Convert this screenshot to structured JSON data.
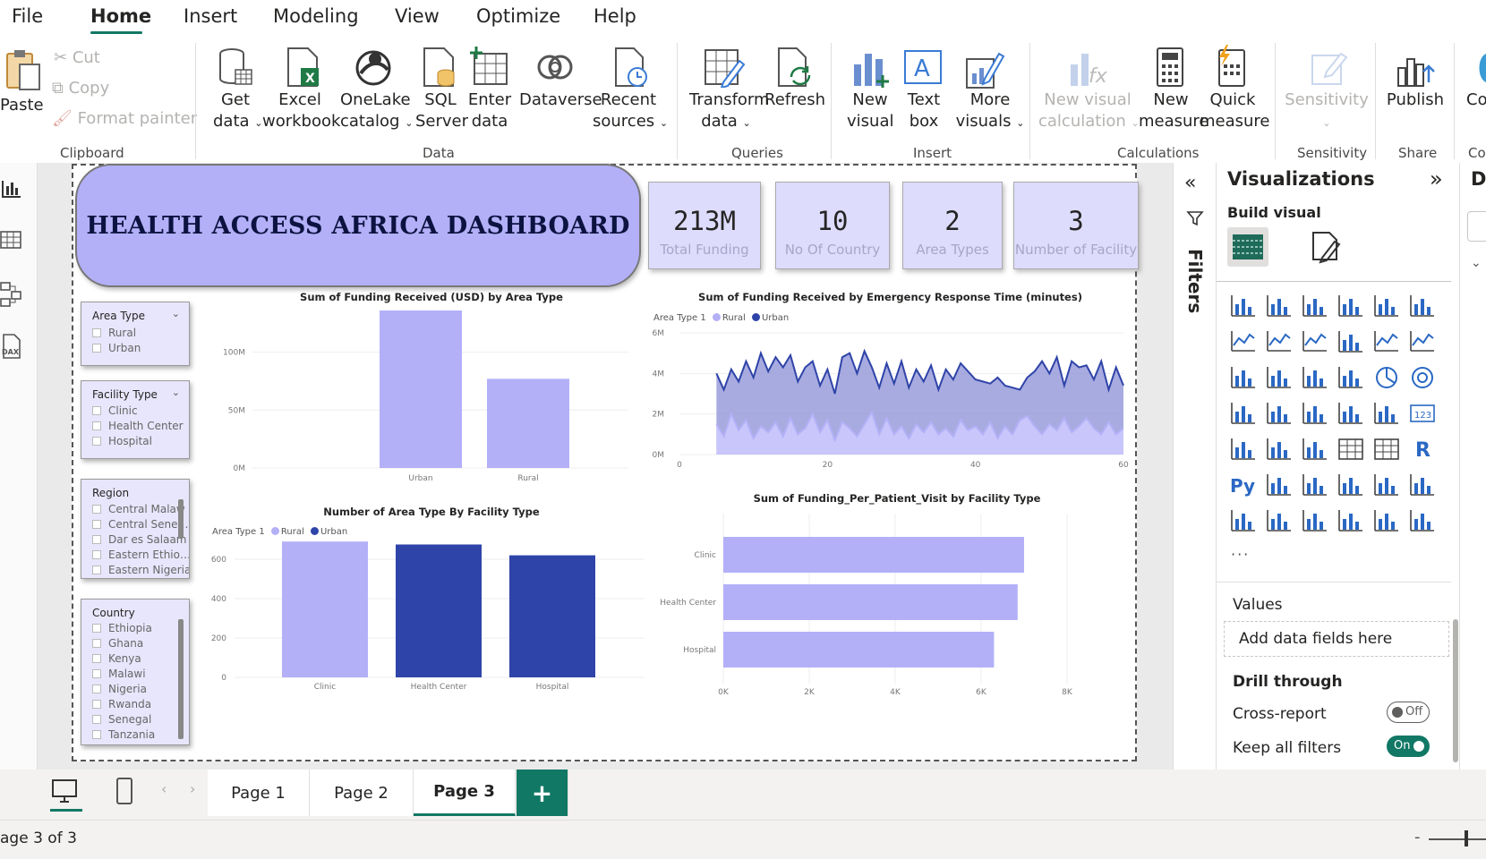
{
  "menu": {
    "items": [
      "File",
      "Home",
      "Insert",
      "Modeling",
      "View",
      "Optimize",
      "Help"
    ],
    "active": "Home"
  },
  "ribbon": {
    "clipboard": {
      "paste": "Paste",
      "cut": "Cut",
      "copy": "Copy",
      "format_painter": "Format painter",
      "group": "Clipboard"
    },
    "data": {
      "get_data": [
        "Get",
        "data"
      ],
      "excel": [
        "Excel",
        "workbook"
      ],
      "onelake": [
        "OneLake",
        "catalog"
      ],
      "sql": [
        "SQL",
        "Server"
      ],
      "enter": [
        "Enter",
        "data"
      ],
      "dataverse": "Dataverse",
      "recent": [
        "Recent",
        "sources"
      ],
      "group": "Data"
    },
    "queries": {
      "transform": [
        "Transform",
        "data"
      ],
      "refresh": "Refresh",
      "group": "Queries"
    },
    "insert": {
      "new_visual": [
        "New",
        "visual"
      ],
      "text_box": [
        "Text",
        "box"
      ],
      "more_visuals": [
        "More",
        "visuals"
      ],
      "group": "Insert"
    },
    "calculations": {
      "new_visual_calc": [
        "New visual",
        "calculation"
      ],
      "new_measure": [
        "New",
        "measure"
      ],
      "quick_measure": [
        "Quick",
        "measure"
      ],
      "group": "Calculations"
    },
    "sensitivity": {
      "label": "Sensitivity",
      "group": "Sensitivity"
    },
    "share": {
      "publish": "Publish",
      "group": "Share",
      "cut_label": "Co"
    }
  },
  "report": {
    "title": "HEALTH ACCESS AFRICA DASHBOARD",
    "kpis": [
      {
        "value": "213M",
        "label": "Total Funding"
      },
      {
        "value": "10",
        "label": "No Of Country"
      },
      {
        "value": "2",
        "label": "Area Types"
      },
      {
        "value": "3",
        "label": "Number of Facility"
      }
    ],
    "slicers": {
      "area_type": {
        "title": "Area Type",
        "items": [
          "Rural",
          "Urban"
        ]
      },
      "facility_type": {
        "title": "Facility Type",
        "items": [
          "Clinic",
          "Health Center",
          "Hospital"
        ]
      },
      "region": {
        "title": "Region",
        "items": [
          "Central Malaw",
          "Central Sene…",
          "Dar es Salaam",
          "Eastern Ethio…",
          "Eastern Nigeria"
        ]
      },
      "country": {
        "title": "Country",
        "items": [
          "Ethiopia",
          "Ghana",
          "Kenya",
          "Malawi",
          "Nigeria",
          "Rwanda",
          "Senegal",
          "Tanzania"
        ]
      }
    }
  },
  "colors": {
    "light_purple": "#b3b0f8",
    "navy": "#2f44a8",
    "teal": "#117865"
  },
  "chart_data": [
    {
      "type": "bar",
      "title": "Sum of Funding Received (USD) by Area Type",
      "categories": [
        "Urban",
        "Rural"
      ],
      "values": [
        136000000,
        77000000
      ],
      "ylim": [
        0,
        136000000
      ],
      "yticks": [
        "0M",
        "50M",
        "100M"
      ],
      "ytick_values": [
        0,
        50000000,
        100000000
      ]
    },
    {
      "type": "area",
      "title": "Sum of Funding Received by Emergency Response Time (minutes)",
      "legend_title": "Area Type 1",
      "legend": [
        "Rural",
        "Urban"
      ],
      "x": [
        5,
        6,
        7,
        8,
        9,
        10,
        11,
        12,
        13,
        14,
        15,
        16,
        17,
        18,
        19,
        20,
        21,
        22,
        23,
        24,
        25,
        26,
        27,
        28,
        29,
        30,
        31,
        32,
        33,
        34,
        35,
        36,
        37,
        38,
        39,
        40,
        41,
        42,
        43,
        44,
        45,
        46,
        47,
        48,
        49,
        50,
        51,
        52,
        53,
        54,
        55,
        56,
        57,
        58,
        59,
        60
      ],
      "series": [
        {
          "name": "Urban",
          "values": [
            4.0,
            3.2,
            4.2,
            3.6,
            4.6,
            3.8,
            5.0,
            4.1,
            4.8,
            4.3,
            4.9,
            3.6,
            4.3,
            4.6,
            3.4,
            4.2,
            3.0,
            4.8,
            5.0,
            4.0,
            5.1,
            4.3,
            3.3,
            4.5,
            3.5,
            4.6,
            3.3,
            4.2,
            3.6,
            4.4,
            3.2,
            4.2,
            3.7,
            4.5,
            4.1,
            3.7,
            3.6,
            3.5,
            3.8,
            3.4,
            3.3,
            3.2,
            3.8,
            4.1,
            4.6,
            4.0,
            4.8,
            3.4,
            4.6,
            4.3,
            4.4,
            3.7,
            4.6,
            3.2,
            4.3,
            3.4,
            4.2,
            3.8,
            3.0,
            3.8
          ]
        },
        {
          "name": "Rural",
          "values": [
            1.5,
            0.9,
            2.0,
            1.2,
            1.7,
            0.8,
            1.4,
            1.1,
            1.6,
            0.9,
            1.8,
            1.0,
            1.3,
            2.0,
            1.1,
            1.7,
            0.7,
            1.6,
            1.3,
            0.9,
            1.5,
            2.1,
            1.0,
            1.8,
            1.0,
            1.4,
            0.8,
            1.5,
            1.1,
            1.6,
            1.0,
            1.3,
            0.9,
            1.7,
            1.2,
            1.4,
            1.0,
            1.6,
            0.8,
            1.4,
            1.0,
            1.7,
            1.9,
            1.4,
            1.0,
            1.5,
            1.2,
            1.8,
            1.1,
            1.4,
            1.8,
            1.3,
            1.0,
            1.6,
            1.0,
            1.3,
            1.9,
            0.9,
            0.7,
            1.4
          ]
        }
      ],
      "ylim": [
        0,
        6
      ],
      "yticks": [
        "0M",
        "2M",
        "4M",
        "6M"
      ],
      "xticks": [
        0,
        20,
        40,
        60
      ]
    },
    {
      "type": "bar",
      "title": "Number of Area Type By Facility Type",
      "legend_title": "Area Type 1",
      "legend": [
        "Rural",
        "Urban"
      ],
      "categories": [
        "Clinic",
        "Health Center",
        "Hospital"
      ],
      "series": [
        {
          "name": "Rural",
          "values": [
            690,
            0,
            0
          ]
        },
        {
          "name": "Urban",
          "values": [
            0,
            675,
            620
          ]
        }
      ],
      "ylim": [
        0,
        700
      ],
      "yticks": [
        0,
        200,
        400,
        600
      ]
    },
    {
      "type": "bar",
      "title": "Sum of Funding_Per_Patient_Visit by Facility Type",
      "orientation": "horizontal",
      "categories": [
        "Clinic",
        "Health Center",
        "Hospital"
      ],
      "values": [
        7000,
        6850,
        6300
      ],
      "xlim": [
        0,
        8000
      ],
      "xticks": [
        "0K",
        "2K",
        "4K",
        "6K",
        "8K"
      ]
    }
  ],
  "panes": {
    "filters": "Filters",
    "visualizations": {
      "title": "Visualizations",
      "build_visual": "Build visual",
      "values": "Values",
      "add_fields": "Add data fields here",
      "drill_through": "Drill through",
      "cross_report": "Cross-report",
      "cross_report_state": "Off",
      "keep_filters": "Keep all filters",
      "keep_filters_state": "On",
      "more": "···"
    },
    "data_cut": "D"
  },
  "pages": {
    "tabs": [
      "Page 1",
      "Page 2",
      "Page 3"
    ],
    "active": "Page 3",
    "add": "+"
  },
  "status": {
    "page_info": "age 3 of 3"
  }
}
